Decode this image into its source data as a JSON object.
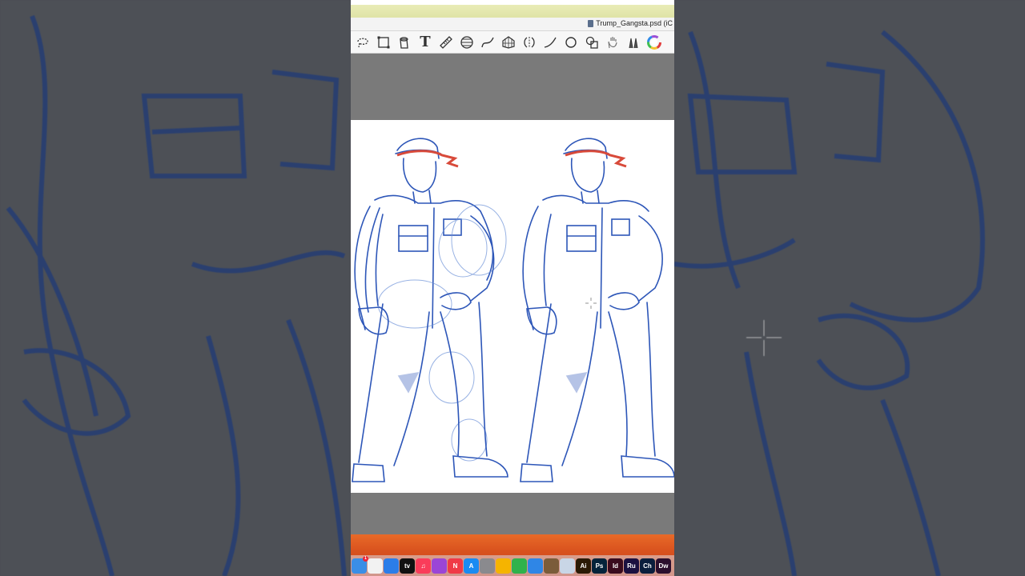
{
  "window": {
    "document_title": "Trump_Gangsta.psd (iC"
  },
  "toolbar": {
    "tools": [
      {
        "name": "lasso-icon"
      },
      {
        "name": "transform-icon"
      },
      {
        "name": "fill-bucket-icon"
      },
      {
        "name": "text-icon",
        "glyph": "T"
      },
      {
        "name": "ruler-icon"
      },
      {
        "name": "perspective-guide-icon"
      },
      {
        "name": "curve-icon"
      },
      {
        "name": "grid-icon"
      },
      {
        "name": "symmetry-icon"
      },
      {
        "name": "line-icon"
      },
      {
        "name": "ellipse-icon"
      },
      {
        "name": "shapes-icon"
      },
      {
        "name": "hand-icon"
      },
      {
        "name": "brush-icon"
      },
      {
        "name": "color-wheel-icon"
      }
    ]
  },
  "dock": {
    "apps": [
      {
        "name": "finder-icon",
        "color": "#3a8ee6",
        "label": ""
      },
      {
        "name": "files-icon",
        "color": "#f2f2f2",
        "label": ""
      },
      {
        "name": "safari-icon",
        "color": "#2b7de9",
        "label": ""
      },
      {
        "name": "apple-tv-icon",
        "color": "#111111",
        "label": "tv"
      },
      {
        "name": "music-icon",
        "color": "#fa3c5a",
        "label": "♫"
      },
      {
        "name": "podcasts-icon",
        "color": "#9b45d6",
        "label": ""
      },
      {
        "name": "news-icon",
        "color": "#f03a47",
        "label": "N"
      },
      {
        "name": "app-store-icon",
        "color": "#1a8bf2",
        "label": "A"
      },
      {
        "name": "system-preferences-icon",
        "color": "#8a8a8e",
        "label": ""
      },
      {
        "name": "pencil-app-icon",
        "color": "#f5b400",
        "label": ""
      },
      {
        "name": "numbers-icon",
        "color": "#2fb24c",
        "label": ""
      },
      {
        "name": "keynote-icon",
        "color": "#2f86e6",
        "label": ""
      },
      {
        "name": "utility-icon",
        "color": "#7b5c3a",
        "label": ""
      },
      {
        "name": "preview-icon",
        "color": "#c9d6e6",
        "label": ""
      },
      {
        "name": "illustrator-icon",
        "color": "#2a1a05",
        "label": "Ai"
      },
      {
        "name": "photoshop-icon",
        "color": "#04233a",
        "label": "Ps"
      },
      {
        "name": "indesign-icon",
        "color": "#3a0b1e",
        "label": "Id"
      },
      {
        "name": "rush-icon",
        "color": "#1b1040",
        "label": "Ru"
      },
      {
        "name": "character-animator-icon",
        "color": "#0a1e3d",
        "label": "Ch"
      },
      {
        "name": "dreamweaver-icon",
        "color": "#2b0f2e",
        "label": "Dw"
      }
    ],
    "badge_count": "1"
  },
  "colors": {
    "sketch_blue": "#2d56b8",
    "bandana_red": "#d84a3a",
    "canvas_gray": "#7a7a7a"
  }
}
